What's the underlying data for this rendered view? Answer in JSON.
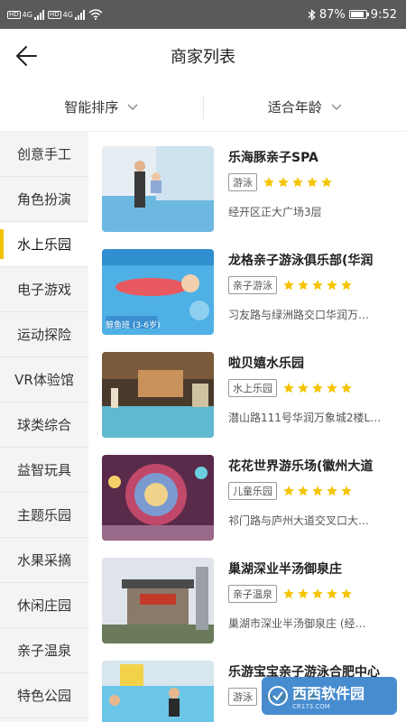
{
  "status_bar": {
    "sim1_hd": "HD",
    "sim1_gen": "4G",
    "sim2_hd": "HD",
    "sim2_gen": "4G",
    "battery": "87%",
    "battery_level": 0.87,
    "time": "9:52",
    "icons": [
      "signal-icon",
      "wifi-icon",
      "bluetooth-icon",
      "battery-icon"
    ]
  },
  "header": {
    "title": "商家列表"
  },
  "filters": [
    {
      "label": "智能排序"
    },
    {
      "label": "适合年龄"
    }
  ],
  "sidebar": {
    "active_index": 2,
    "items": [
      {
        "label": "创意手工"
      },
      {
        "label": "角色扮演"
      },
      {
        "label": "水上乐园"
      },
      {
        "label": "电子游戏"
      },
      {
        "label": "运动探险"
      },
      {
        "label": "VR体验馆"
      },
      {
        "label": "球类综合"
      },
      {
        "label": "益智玩具"
      },
      {
        "label": "主题乐园"
      },
      {
        "label": "水果采摘"
      },
      {
        "label": "休闲庄园"
      },
      {
        "label": "亲子温泉"
      },
      {
        "label": "特色公园"
      }
    ]
  },
  "merchants": [
    {
      "name": "乐海豚亲子SPA",
      "tag": "游泳",
      "rating": 5,
      "address": "经开区正大广场3层"
    },
    {
      "name": "龙格亲子游泳俱乐部(华润",
      "tag": "亲子游泳",
      "rating": 5,
      "address": "习友路与绿洲路交口华润万…",
      "image_caption": "鲸鱼班 (3-6岁)"
    },
    {
      "name": "啦贝嬉水乐园",
      "tag": "水上乐园",
      "rating": 5,
      "address": "潜山路111号华润万象城2楼L…"
    },
    {
      "name": "花花世界游乐场(徽州大道",
      "tag": "儿童乐园",
      "rating": 5,
      "address": "祁门路与庐州大道交叉口大…"
    },
    {
      "name": "巢湖深业半汤御泉庄",
      "tag": "亲子温泉",
      "rating": 5,
      "address": "巢湖市深业半汤御泉庄 (经…"
    },
    {
      "name": "乐游宝宝亲子游泳合肥中心",
      "tag": "游泳",
      "rating": 5,
      "address": ""
    }
  ],
  "watermark": {
    "logo": "西西软件园",
    "sub": "CR173.COM"
  },
  "colors": {
    "accent": "#f2c100",
    "star": "#f5c400",
    "status_bar": "#5a5a5a"
  }
}
